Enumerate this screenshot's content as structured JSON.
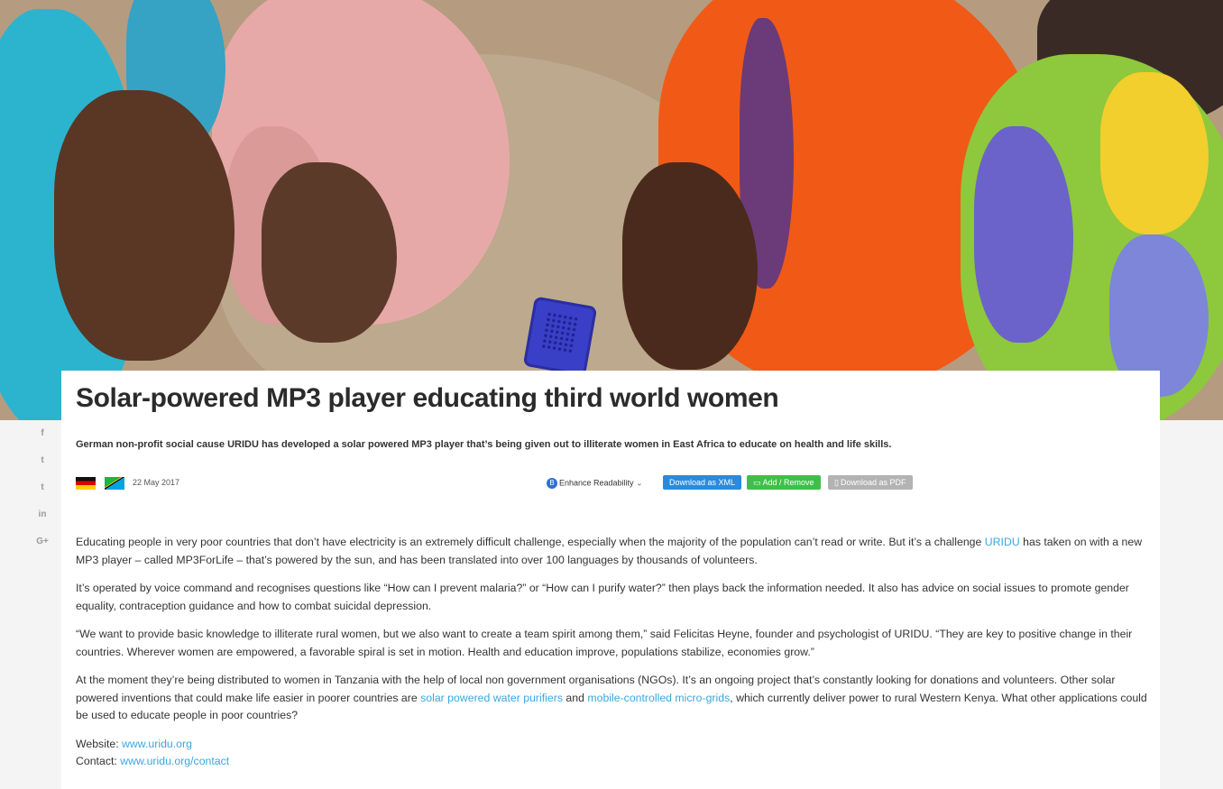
{
  "article": {
    "title": "Solar-powered MP3 player educating third world women",
    "lede": "German non-profit social cause URIDU has developed a solar powered MP3 player that’s being given out to illiterate women in East Africa to educate on health and life skills.",
    "date": "22 May 2017",
    "flags": [
      "germany-flag",
      "tanzania-flag"
    ],
    "paragraphs": {
      "p1_a": "Educating people in very poor countries that don’t have electricity is an extremely difficult challenge, especially when the majority of the population can’t read or write. But it’s a challenge ",
      "p1_link": "URIDU",
      "p1_b": " has taken on with a new MP3 player – called MP3ForLife – that’s powered by the sun, and has been translated into over 100 languages by thousands of volunteers.",
      "p2": "It’s operated by voice command and recognises questions like “How can I prevent malaria?” or “How can I purify water?” then plays back the information needed. It also has advice on social issues to promote gender equality, contraception guidance and how to combat suicidal depression.",
      "p3": "“We want to provide basic knowledge to illiterate rural women, but we also want to create a team spirit among them,” said Felicitas Heyne, founder and psychologist of URIDU. “They are key to positive change in their countries. Wherever women are empowered, a favorable spiral is set in motion. Health and education improve, populations stabilize, economies grow.”",
      "p4_a": "At the moment they’re being distributed to women in Tanzania with the help of local non government organisations (NGOs). It’s an ongoing project that’s constantly looking for donations and volunteers. Other solar powered inventions that could make life easier in poorer countries are ",
      "p4_link1": "solar powered water purifiers",
      "p4_mid": " and ",
      "p4_link2": "mobile-controlled micro-grids",
      "p4_b": ", which currently deliver power to rural Western Kenya. What other applications could be used to educate people in poor countries?"
    },
    "website_label": "Website: ",
    "website_link": "www.uridu.org",
    "contact_label": "Contact: ",
    "contact_link": "www.uridu.org/contact"
  },
  "toolbar": {
    "enhance_badge": "B",
    "enhance_label": "Enhance Readability",
    "enhance_chevron": "⌄",
    "xml_label": "Download as XML",
    "add_icon": "▭",
    "add_label": "Add / Remove",
    "pdf_icon": "▯",
    "pdf_label": "Download as PDF"
  },
  "share": {
    "facebook": "f",
    "twitter": "t",
    "tumblr": "t",
    "linkedin": "in",
    "googleplus": "G+"
  },
  "colors": {
    "link": "#3aa7df",
    "xml_button": "#2a8bdc",
    "add_button": "#3fbf4a",
    "pdf_button": "#b3b3b3"
  }
}
